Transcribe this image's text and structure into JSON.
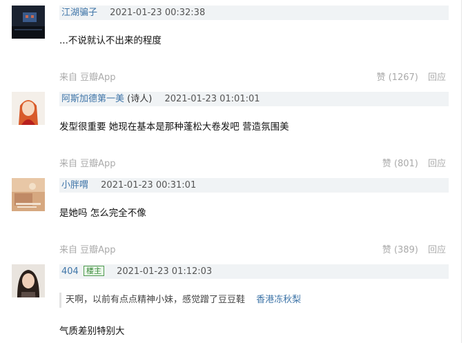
{
  "comments": [
    {
      "user": "江湖骗子",
      "suffix": "",
      "badge": "",
      "time": "2021-01-23 00:32:38",
      "text": "...不说就认不出来的程度",
      "source": "来自 豆瓣App",
      "like_label": "赞 (1267)",
      "reply_label": "回应"
    },
    {
      "user": "阿斯加德第一美",
      "suffix": "(诗人)",
      "badge": "",
      "time": "2021-01-23 01:01:01",
      "text": "发型很重要 她现在基本是那种蓬松大卷发吧 营造氛围美",
      "source": "来自 豆瓣App",
      "like_label": "赞 (801)",
      "reply_label": "回应"
    },
    {
      "user": "小胖喟",
      "suffix": "",
      "badge": "",
      "time": "2021-01-23 00:31:01",
      "text": "是她吗 怎么完全不像",
      "source": "来自 豆瓣App",
      "like_label": "赞 (389)",
      "reply_label": "回应"
    },
    {
      "user": "404",
      "suffix": "",
      "badge": "楼主",
      "time": "2021-01-23 01:12:03",
      "quote_text": "天啊，以前有点点精神小妹，感觉蹭了豆豆鞋",
      "quote_author": "香港冻秋梨",
      "text": "气质差别特别大"
    }
  ]
}
